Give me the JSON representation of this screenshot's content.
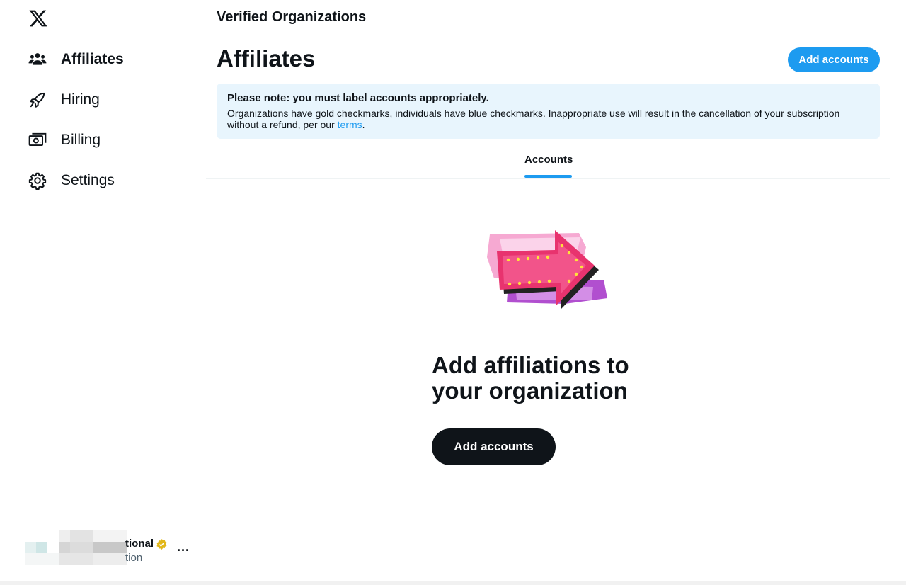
{
  "sidebar": {
    "items": [
      {
        "label": "Affiliates",
        "icon": "people-icon",
        "active": true
      },
      {
        "label": "Hiring",
        "icon": "rocket-icon"
      },
      {
        "label": "Billing",
        "icon": "billing-icon"
      },
      {
        "label": "Settings",
        "icon": "gear-icon"
      }
    ],
    "account": {
      "name_fragment": "tional",
      "handle_fragment": "tion",
      "more": "..."
    }
  },
  "header": {
    "title": "Verified Organizations",
    "page_title": "Affiliates",
    "add_button": "Add accounts"
  },
  "notice": {
    "title": "Please note: you must label accounts appropriately.",
    "body_before_link": "Organizations have gold checkmarks, individuals have blue checkmarks. Inappropriate use will result in the cancellation of your subscription without a refund, per our ",
    "link": "terms",
    "body_after_link": "."
  },
  "tabs": [
    {
      "label": "Accounts",
      "active": true
    }
  ],
  "empty_state": {
    "title": "Add affiliations to your organization",
    "button": "Add accounts"
  },
  "colors": {
    "accent": "#1d9bf0",
    "text": "#0f1419",
    "notice_bg": "#e8f5fd",
    "gold_badge": "#e2b719"
  }
}
